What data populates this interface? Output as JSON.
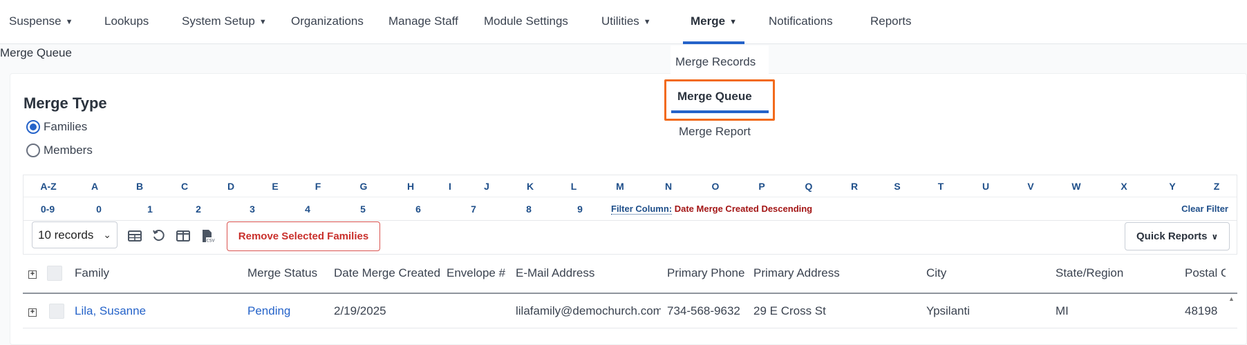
{
  "nav": {
    "items": [
      {
        "label": "Suspense",
        "caret": "▼"
      },
      {
        "label": "Lookups",
        "caret": ""
      },
      {
        "label": "System Setup",
        "caret": "▼"
      },
      {
        "label": "Organizations",
        "caret": ""
      },
      {
        "label": "Manage Staff",
        "caret": ""
      },
      {
        "label": "Module Settings",
        "caret": ""
      },
      {
        "label": "Utilities",
        "caret": "▼"
      },
      {
        "label": "Merge",
        "caret": "▼"
      },
      {
        "label": "Notifications",
        "caret": ""
      },
      {
        "label": "Reports",
        "caret": ""
      }
    ]
  },
  "page": {
    "title": "Merge Queue"
  },
  "merge_dropdown": {
    "items": [
      "Merge Records",
      "Merge Queue",
      "Merge Report"
    ],
    "selected": "Merge Queue"
  },
  "merge_type": {
    "title": "Merge Type",
    "options": [
      {
        "label": "Families",
        "checked": true
      },
      {
        "label": "Members",
        "checked": false
      }
    ]
  },
  "filter": {
    "letters": [
      "A-Z",
      "A",
      "B",
      "C",
      "D",
      "E",
      "F",
      "G",
      "H",
      "I",
      "J",
      "K",
      "L",
      "M",
      "N",
      "O",
      "P",
      "Q",
      "R",
      "S",
      "T",
      "U",
      "V",
      "W",
      "X",
      "Y",
      "Z"
    ],
    "numbers": [
      "0-9",
      "0",
      "1",
      "2",
      "3",
      "4",
      "5",
      "6",
      "7",
      "8",
      "9"
    ],
    "column_label": "Filter Column:",
    "column_value": "Date Merge Created Descending",
    "clear_label": "Clear Filter"
  },
  "toolbar": {
    "records_value": "10 records",
    "icons": [
      "table-view-icon",
      "refresh-icon",
      "columns-icon",
      "csv-export-icon"
    ],
    "remove_label": "Remove Selected Families",
    "quick_reports_label": "Quick Reports"
  },
  "table": {
    "columns": [
      "Family",
      "Merge Status",
      "Date Merge Created",
      "Envelope #",
      "E-Mail Address",
      "Primary Phone",
      "Primary Address",
      "City",
      "State/Region",
      "Postal Code"
    ],
    "rows": [
      {
        "family": "Lila, Susanne",
        "merge_status": "Pending",
        "date_merge_created": "2/19/2025",
        "envelope": "",
        "email": "lilafamily@demochurch.com",
        "phone": "734-568-9632",
        "address": "29 E Cross St",
        "city": "Ypsilanti",
        "state": "MI",
        "postal": "48198"
      }
    ]
  },
  "colors": {
    "accent": "#2563c9",
    "highlight": "#f26a1b",
    "danger": "#c9302c",
    "filter_link": "#1f4f8a"
  }
}
